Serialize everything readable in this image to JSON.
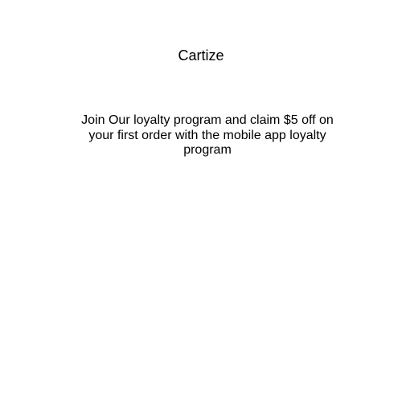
{
  "app": {
    "brand_name": "Cartize"
  },
  "promo": {
    "message": "Join Our loyalty program and claim $5 off on your first order with the mobile app loyalty program"
  }
}
